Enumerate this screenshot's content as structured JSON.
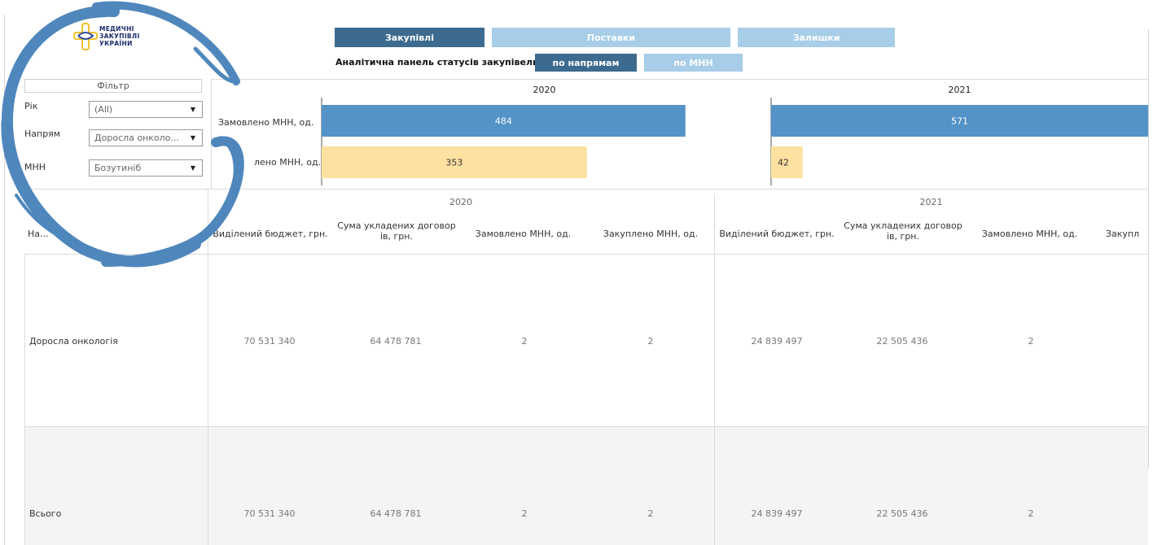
{
  "logo": {
    "line1": "МЕДИЧНІ",
    "line2": "ЗАКУПІВЛІ",
    "line3": "УКРАЇНИ"
  },
  "tabs": [
    {
      "label": "Закупівлі",
      "active": true
    },
    {
      "label": "Поставки",
      "active": false
    },
    {
      "label": "Залишки",
      "active": false
    }
  ],
  "panel": {
    "label": "Аналітична панель статусів закупівель:",
    "subtabs": [
      {
        "label": "по напрямам",
        "active": true
      },
      {
        "label": "по МНН",
        "active": false
      }
    ]
  },
  "filter": {
    "title": "Фільтр",
    "fields": [
      {
        "label": "Рік",
        "value": "(All)"
      },
      {
        "label": "Напрям",
        "value": "Доросла онколо..."
      },
      {
        "label": "МНН",
        "value": "Бозутиніб"
      }
    ]
  },
  "colors": {
    "ordered": "#5393c7",
    "purchased": "#fde1a0",
    "tab_active": "#3d6b8f",
    "tab_inactive": "#a7cde8"
  },
  "chart_data": {
    "type": "bar",
    "orientation": "horizontal",
    "panels": [
      "2020",
      "2021"
    ],
    "categories": [
      "Замовлено МНН, од.",
      "...лено МНН, од."
    ],
    "visible_category_labels": [
      "Замовлено МНН, од.",
      "лено МНН, од."
    ],
    "series": [
      {
        "panel": "2020",
        "values": [
          484,
          353
        ]
      },
      {
        "panel": "2021",
        "values": [
          571,
          42
        ]
      }
    ],
    "data_labels": {
      "2020": [
        "484",
        "353"
      ],
      "2021": [
        "571",
        "42"
      ]
    }
  },
  "table": {
    "years": [
      "2020",
      "2021"
    ],
    "row_header_partial": "На...",
    "columns_2020": [
      "Виділений бюджет, грн.",
      "Сума укладених договор ів, грн.",
      "Замовлено МНН, од.",
      "Закуплено МНН, од."
    ],
    "columns_2021": [
      "Виділений бюджет, грн.",
      "Сума укладених договор ів, грн.",
      "Замовлено МНН, од.",
      "Закупл"
    ],
    "rows": [
      {
        "label": "Доросла онкологія",
        "v2020": [
          "70 531 340",
          "64 478 781",
          "2",
          "2"
        ],
        "v2021": [
          "24 839 497",
          "22 505 436",
          "2"
        ]
      },
      {
        "label": "Всього",
        "v2020": [
          "70 531 340",
          "64 478 781",
          "2",
          "2"
        ],
        "v2021": [
          "24 839 497",
          "22 505 436",
          "2"
        ]
      }
    ]
  }
}
